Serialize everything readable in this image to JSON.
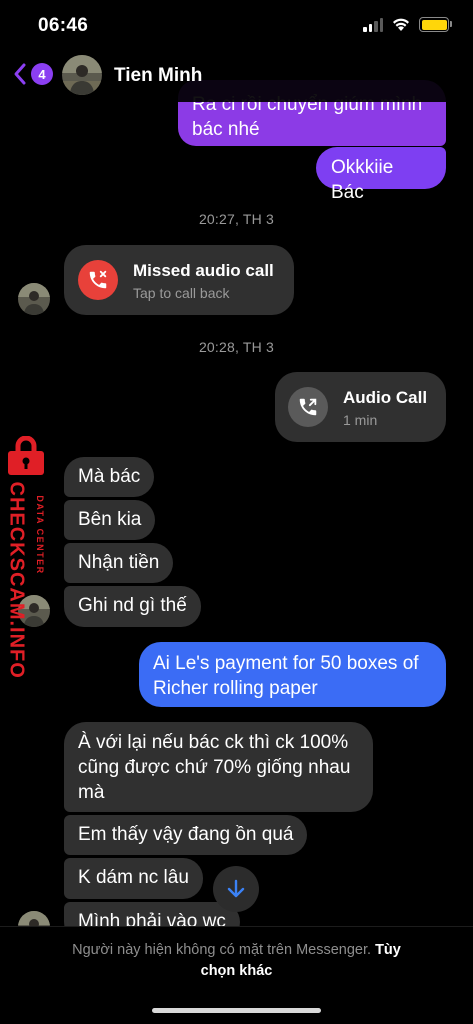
{
  "status_bar": {
    "time": "06:46"
  },
  "header": {
    "unread_count": "4",
    "contact_name": "Tien Minh"
  },
  "messages": {
    "m1_line1": "Ra ci rồi chuyển giúm mình",
    "m1_line2": "bác nhé",
    "m2": "Okkkiie Bác",
    "stamp1": "20:27, TH 3",
    "missed_call_title": "Missed audio call",
    "missed_call_sub": "Tap to call back",
    "stamp2": "20:28, TH 3",
    "audio_call_title": "Audio Call",
    "audio_call_sub": "1 min",
    "in1": "Mà bác",
    "in2": "Bên kia",
    "in3": "Nhận tiền",
    "in4": "Ghi nd gì thế",
    "out_blue_line1": "Ai Le's payment for 50 boxes of",
    "out_blue_line2": "Richer rolling paper",
    "in5_line1": "À với lại nếu bác ck thì ck 100%",
    "in5_line2": "cũng được chứ 70% giống nhau",
    "in5_line3": "mà",
    "in6": "Em thấy vậy đang ồn quá",
    "in7": "K dám nc lâu",
    "in8": "Mình phải vào wc"
  },
  "watermark": {
    "brand": "CHECKSCAM.INFO",
    "sub": "DATA CENTER"
  },
  "footer": {
    "notice": "Người này hiện không có mặt trên Messenger.",
    "link_part1": "Tùy",
    "link_part2": "chọn khác"
  },
  "colors": {
    "accent_purple": "#8c3be6",
    "blue": "#3b6cf5",
    "missed_red": "#e8413a",
    "bubble_gray": "#303030"
  }
}
